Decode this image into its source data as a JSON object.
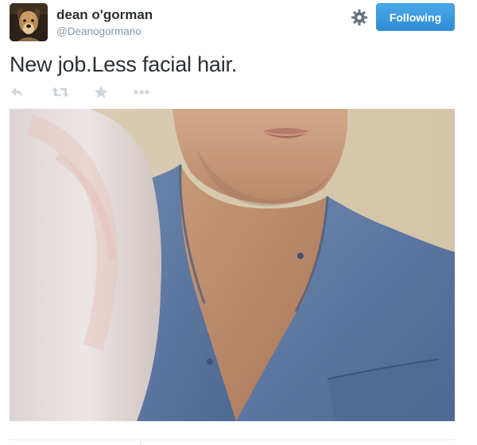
{
  "tweet": {
    "display_name": "dean o'gorman",
    "handle": "@Deanogormano",
    "text": "New job.Less facial hair.",
    "follow_label": "Following"
  },
  "icons": {
    "avatar": "dog-avatar",
    "settings": "gear-icon",
    "reply": "reply-icon",
    "retweet": "retweet-icon",
    "favorite": "star-icon",
    "more": "more-icon"
  },
  "colors": {
    "follow_button": "#3b94d9",
    "action_icons": "#ccd6dd",
    "handle_text": "#8899a6",
    "name_text": "#292f33"
  }
}
